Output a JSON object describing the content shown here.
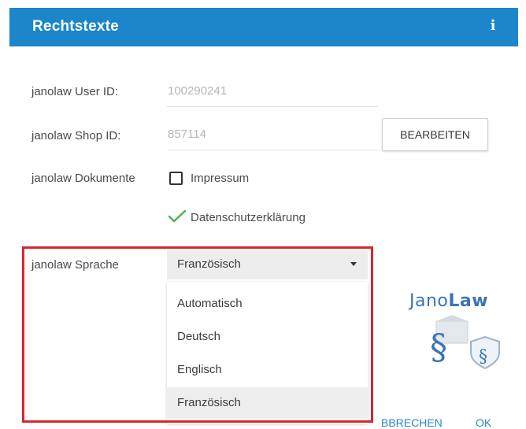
{
  "header": {
    "title": "Rechtstexte",
    "info_glyph": "i",
    "background": "#1b86c9"
  },
  "form": {
    "user_id": {
      "label": "janolaw User ID:",
      "value": "100290241"
    },
    "shop_id": {
      "label": "janolaw Shop ID:",
      "value": "857114",
      "button": "BEARBEITEN"
    },
    "documents": {
      "label": "janolaw Dokumente",
      "items": [
        {
          "label": "Impressum",
          "checked": false
        },
        {
          "label": "Datenschutzerklärung",
          "checked": true
        }
      ]
    },
    "language": {
      "label": "janolaw Sprache",
      "selected": "Französisch",
      "options": [
        "Automatisch",
        "Deutsch",
        "Englisch",
        "Französisch"
      ]
    }
  },
  "logo": {
    "wordmark_light": "Jano",
    "wordmark_bold": "Law"
  },
  "footer": {
    "cancel": "BBRECHEN",
    "ok": "OK"
  },
  "colors": {
    "highlight": "#d7262d",
    "check": "#4caf50",
    "link": "#2a86c9"
  }
}
